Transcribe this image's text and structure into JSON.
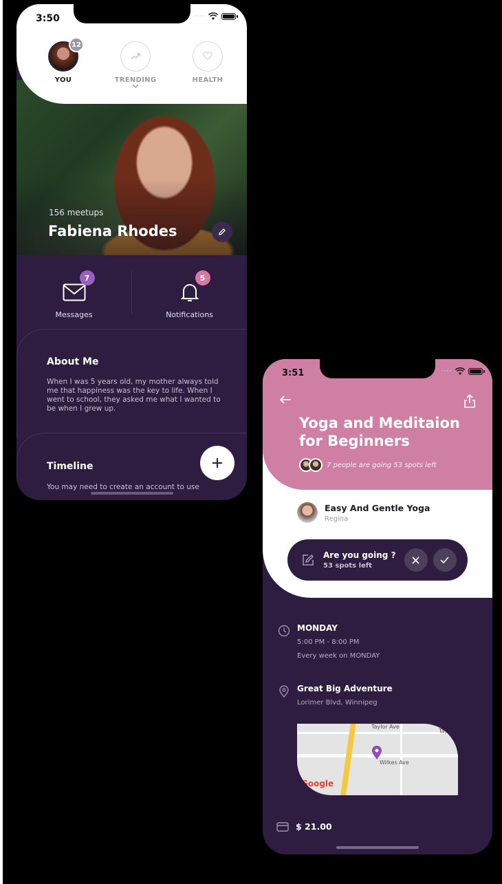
{
  "phone1": {
    "status_time": "3:50",
    "tabs": [
      {
        "label": "YOU",
        "badge": "12"
      },
      {
        "label": "TRENDING"
      },
      {
        "label": "HEALTH"
      }
    ],
    "profile": {
      "meetups": "156 meetups",
      "name": "Fabiena Rhodes"
    },
    "stats": [
      {
        "label": "Messages",
        "badge": "7",
        "badge_color": "#9b5fc0"
      },
      {
        "label": "Notifications",
        "badge": "5",
        "badge_color": "#d67aa4"
      }
    ],
    "about": {
      "title": "About Me",
      "text": "When I was 5 years old, my mother always told me that happiness was the key to life. When I went to school, they asked me what I wanted to be when I grew up."
    },
    "timeline": {
      "title": "Timeline",
      "text": "You may need to create an account to use"
    }
  },
  "phone2": {
    "status_time": "3:51",
    "event_title": "Yoga and Meditaion for Beginners",
    "going_text": "7 people are going 53 spots left",
    "host": {
      "title": "Easy And Gentle Yoga",
      "name": "Regina"
    },
    "rsvp": {
      "question": "Are you going ?",
      "spots": "53 spots left"
    },
    "schedule": {
      "day": "MONDAY",
      "time": "5:00 PM - 8:00 PM",
      "recurrence": "Every week on MONDAY"
    },
    "location": {
      "name": "Great Big Adventure",
      "address": "Lorimer Blvd, Winnipeg"
    },
    "map": {
      "street1": "Taylor Ave",
      "street2": "Wilkes Ave",
      "street3": "Tay",
      "logo": "Google"
    },
    "price": "$ 21.00"
  },
  "colors": {
    "dark_purple": "#2e1d40",
    "pink": "#cf7ea4",
    "accent_purple": "#9b5fc0"
  }
}
